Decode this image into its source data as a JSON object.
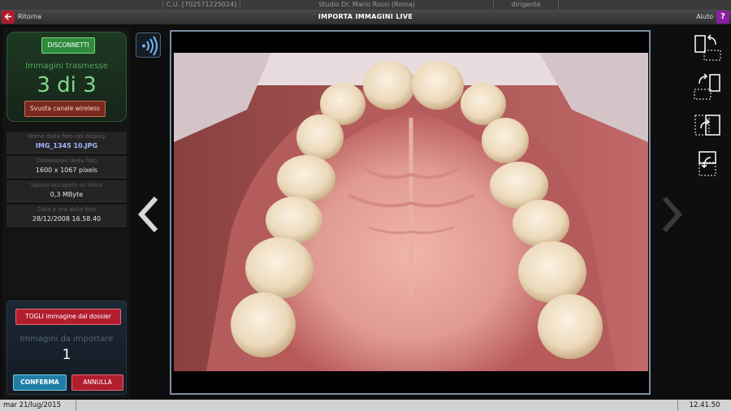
{
  "header": {
    "cu_code": "C.U. [702571225024]",
    "studio": "Studio Dr. Mario Rossi (Roma)",
    "role": "dirigente"
  },
  "titlebar": {
    "back_label": "Ritorna",
    "title": "IMPORTA IMMAGINI LIVE",
    "help_label": "Aiuto",
    "help_symbol": "?"
  },
  "connection": {
    "disconnect_label": "DISCONNETTI",
    "transmitted_label": "Immagini trasmesse",
    "transmitted_count": "3 di 3",
    "clear_channel_label": "Svuota canale wireless"
  },
  "photo_info": [
    {
      "label": "Nome della foto nel display",
      "value": "IMG_1345 10.JPG"
    },
    {
      "label": "Dimensioni della foto",
      "value": "1600 x 1067 pixels"
    },
    {
      "label": "Spazio occupato su disco",
      "value": "0,3 MByte"
    },
    {
      "label": "Data e ora della foto",
      "value": "28/12/2008 16.58.40"
    }
  ],
  "import": {
    "remove_label": "TOGLI immagine dal dossier",
    "to_import_label": "Immagini da importare",
    "to_import_count": "1",
    "confirm_label": "CONFERMA",
    "cancel_label": "ANNULLA"
  },
  "toolbar": {
    "icons": [
      "rotate-left-icon",
      "rotate-right-icon",
      "flip-horizontal-icon",
      "flip-vertical-icon"
    ]
  },
  "status": {
    "date": "mar 21/lug/2015",
    "time": "12.41.50"
  },
  "colors": {
    "accent_red": "#b21e2e",
    "accent_green": "#2e8a3a",
    "accent_blue": "#1e7ea6",
    "help_purple": "#8a1fa0"
  }
}
